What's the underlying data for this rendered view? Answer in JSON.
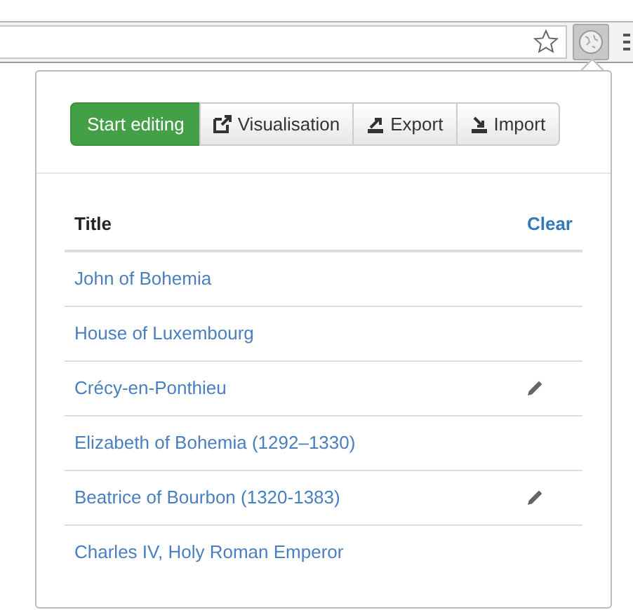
{
  "toolbar": {
    "buttons": [
      {
        "label": "Start editing",
        "kind": "primary"
      },
      {
        "label": "Visualisation",
        "kind": "visualise"
      },
      {
        "label": "Export",
        "kind": "export"
      },
      {
        "label": "Import",
        "kind": "import"
      }
    ]
  },
  "table": {
    "columns": [
      "Title"
    ],
    "clear_link": "Clear",
    "rows": [
      {
        "title": "John of Bohemia",
        "edited": false
      },
      {
        "title": "House of Luxembourg",
        "edited": false
      },
      {
        "title": "Crécy-en-Ponthieu",
        "edited": true
      },
      {
        "title": "Elizabeth of Bohemia (1292–1330)",
        "edited": false
      },
      {
        "title": "Beatrice of Bourbon (1320-1383)",
        "edited": true
      },
      {
        "title": "Charles IV, Holy Roman Emperor",
        "edited": false
      }
    ]
  }
}
